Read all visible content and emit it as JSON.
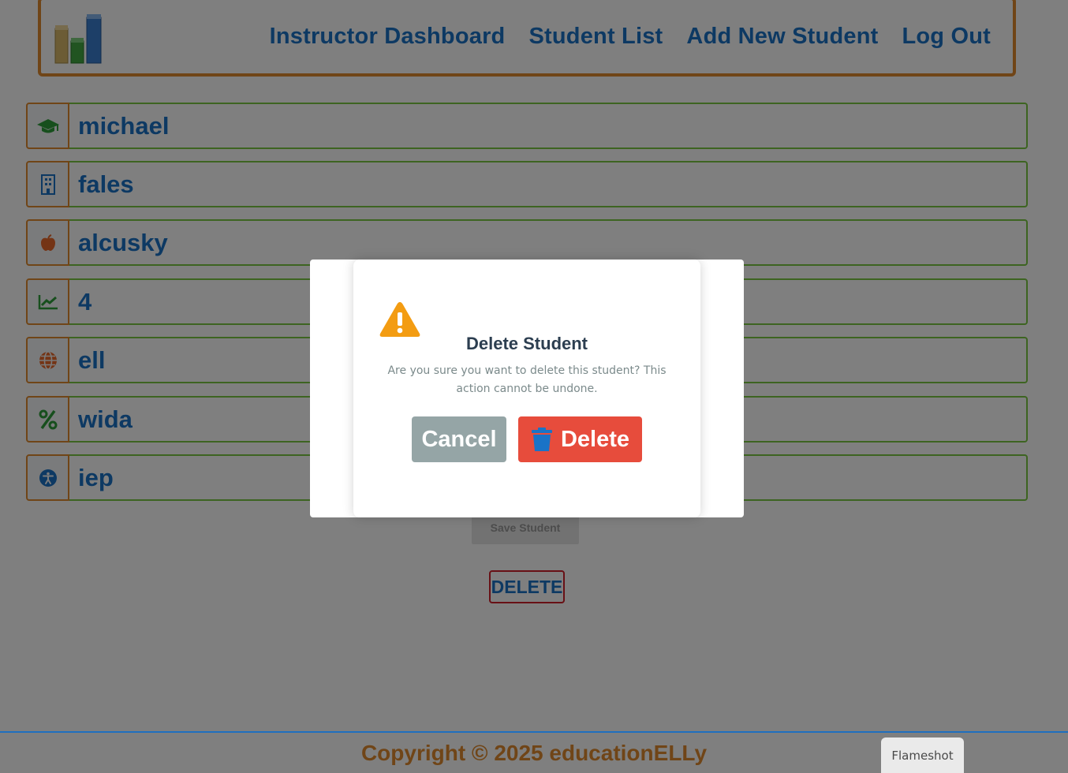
{
  "header": {
    "logo": "bar-chart-logo",
    "nav": [
      {
        "label": "Instructor Dashboard"
      },
      {
        "label": "Student List"
      },
      {
        "label": "Add New Student"
      },
      {
        "label": "Log Out"
      }
    ]
  },
  "form": {
    "fields": [
      {
        "icon": "graduation-cap-icon",
        "value": "michael"
      },
      {
        "icon": "building-icon",
        "value": "fales"
      },
      {
        "icon": "apple-icon",
        "value": "alcusky"
      },
      {
        "icon": "chart-line-icon",
        "value": "4"
      },
      {
        "icon": "globe-icon",
        "value": "ell"
      },
      {
        "icon": "percent-icon",
        "value": "wida"
      },
      {
        "icon": "accessibility-icon",
        "value": "iep"
      }
    ],
    "save_label": "Save Student",
    "delete_label": "DELETE"
  },
  "modal": {
    "title": "Delete Student",
    "message": "Are you sure you want to delete this student? This action cannot be undone.",
    "cancel_label": "Cancel",
    "delete_label": "Delete"
  },
  "footer": {
    "copyright": "Copyright © 2025 educationELLy"
  },
  "taskbar": {
    "flameshot_label": "Flameshot"
  },
  "colors": {
    "brand_orange": "#e08a2e",
    "brand_blue": "#1a73c7",
    "field_border": "#7ac943",
    "danger": "#e74c3c",
    "cancel_gray": "#95a5a6",
    "warning": "#f39c12"
  }
}
